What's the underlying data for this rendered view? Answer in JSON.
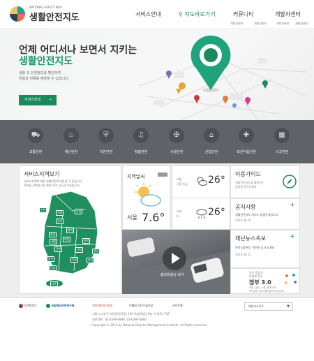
{
  "header": {
    "logo_sub": "NATIONAL SAFETY MAP",
    "logo_title": "생활안전지도",
    "nav": [
      {
        "label": "서비스안내"
      },
      {
        "label": "지도바로가기"
      },
      {
        "label": "커뮤니티"
      },
      {
        "label": "개발자센터"
      }
    ],
    "subnav": [
      "개발자센터",
      "개발자센터",
      "개발자센터",
      "개발자센터"
    ]
  },
  "hero": {
    "headline": "언제 어디서나 보면서 지키는",
    "headline_accent": "생활안전지도",
    "desc1": "생활 속 안전정보를 확인하여",
    "desc2": "위험과 피해를 예방할 수 있습니다.",
    "button": "서비스안내",
    "button_arrow": "→"
  },
  "categories": [
    {
      "label": "교통안전",
      "icon": "car-icon"
    },
    {
      "label": "재난안전",
      "icon": "flame-icon"
    },
    {
      "label": "치안안전",
      "icon": "police-icon"
    },
    {
      "label": "맞춤안전",
      "icon": "bell-icon"
    },
    {
      "label": "시설안전",
      "icon": "wrench-icon"
    },
    {
      "label": "산업안전",
      "icon": "factory-icon"
    },
    {
      "label": "보건식품안전",
      "icon": "health-icon"
    },
    {
      "label": "시고안전",
      "icon": "building-icon"
    }
  ],
  "service_area": {
    "title": "서비스지역보기",
    "desc1": "서비스지역에 대한 생활안전지도를 볼 수 있습니다.",
    "desc2": "지역을 선택하시면 해당 지역 지도로 이동합니다.",
    "regions": [
      "인천",
      "서울",
      "강원",
      "경기",
      "충북",
      "충남",
      "세종",
      "대전",
      "경북",
      "전북",
      "대구",
      "울산",
      "부산",
      "경남",
      "광주",
      "전남",
      "제주"
    ]
  },
  "weather": {
    "title": "지역날씨",
    "city": "서울",
    "temp": "7.6°"
  },
  "forecast": [
    {
      "day": "내일",
      "cond": "구름 조금",
      "temp": "26°"
    },
    {
      "day": "모레",
      "cond": "비",
      "temp": "26°"
    }
  ],
  "guide": {
    "title": "이용가이드",
    "desc1": "생활안전지도를 활용하는",
    "desc2": "방법을 확인하세요"
  },
  "notice": {
    "title": "공지사항",
    "text": "생활안전지도 서비스 점검안내입니다.",
    "date": "2014.08.20"
  },
  "news": {
    "title": "재난뉴스속보",
    "text": "전북소방본부 '안전한 휴가 되세요'",
    "date": "2014.06.15"
  },
  "promo": {
    "line1": "국민 중심의",
    "line2": "맞춤형 정부",
    "brand": "정부 3.0",
    "text1": "개방, 공유, 소통, 협력으로",
    "text2": "여러분의 새시대를 열어가겠습니다"
  },
  "video": {
    "label": "홍보동영상 보기"
  },
  "footer": {
    "org1": "안전행정부",
    "org2": "국립재난안전연구원",
    "links": [
      "개인정보처리방침",
      "이메일 무단수집거부",
      "사이트맵"
    ],
    "address": "서울시 마포구 아현로(공덕동) 136 역삼정빌딩 6층 (우)121-719",
    "phone": "대표전화 : 02-6399-6890, 02-6399-6890",
    "copyright": "Copyright © 2014 by National Disaster Management Institute, All Rights reserved.",
    "family_site": "패밀리사이트"
  },
  "colors": {
    "accent": "#1a8a5c",
    "band": "#5f6266"
  }
}
